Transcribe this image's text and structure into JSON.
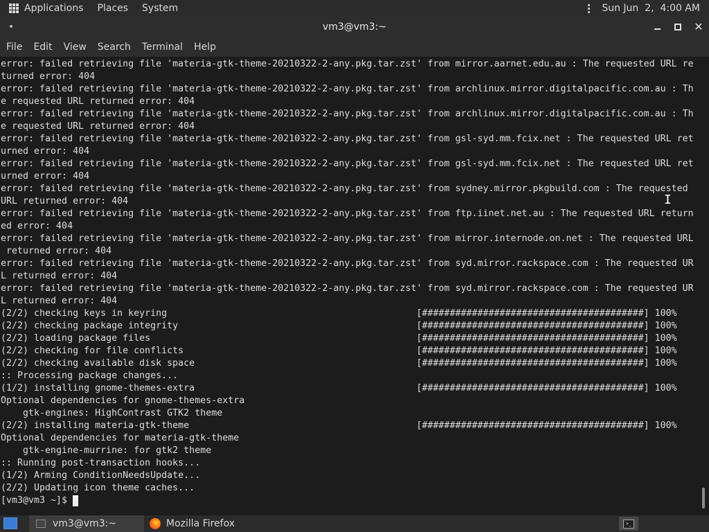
{
  "top_panel": {
    "menus": [
      "Applications",
      "Places",
      "System"
    ],
    "clock": "Sun Jun  2,  4:00 AM"
  },
  "window": {
    "title": "vm3@vm3:~",
    "menu": [
      "File",
      "Edit",
      "View",
      "Search",
      "Terminal",
      "Help"
    ]
  },
  "terminal": {
    "lines": [
      "error: failed retrieving file 'materia-gtk-theme-20210322-2-any.pkg.tar.zst' from mirror.aarnet.edu.au : The requested URL re",
      "turned error: 404",
      "error: failed retrieving file 'materia-gtk-theme-20210322-2-any.pkg.tar.zst' from archlinux.mirror.digitalpacific.com.au : Th",
      "e requested URL returned error: 404",
      "error: failed retrieving file 'materia-gtk-theme-20210322-2-any.pkg.tar.zst' from archlinux.mirror.digitalpacific.com.au : Th",
      "e requested URL returned error: 404",
      "error: failed retrieving file 'materia-gtk-theme-20210322-2-any.pkg.tar.zst' from gsl-syd.mm.fcix.net : The requested URL ret",
      "urned error: 404",
      "error: failed retrieving file 'materia-gtk-theme-20210322-2-any.pkg.tar.zst' from gsl-syd.mm.fcix.net : The requested URL ret",
      "urned error: 404",
      "error: failed retrieving file 'materia-gtk-theme-20210322-2-any.pkg.tar.zst' from sydney.mirror.pkgbuild.com : The requested",
      "URL returned error: 404",
      "error: failed retrieving file 'materia-gtk-theme-20210322-2-any.pkg.tar.zst' from ftp.iinet.net.au : The requested URL return",
      "ed error: 404",
      "error: failed retrieving file 'materia-gtk-theme-20210322-2-any.pkg.tar.zst' from mirror.internode.on.net : The requested URL",
      " returned error: 404",
      "error: failed retrieving file 'materia-gtk-theme-20210322-2-any.pkg.tar.zst' from syd.mirror.rackspace.com : The requested UR",
      "L returned error: 404",
      "error: failed retrieving file 'materia-gtk-theme-20210322-2-any.pkg.tar.zst' from syd.mirror.rackspace.com : The requested UR",
      "L returned error: 404",
      "(2/2) checking keys in keyring                                             [########################################] 100%",
      "(2/2) checking package integrity                                           [########################################] 100%",
      "(2/2) loading package files                                                [########################################] 100%",
      "(2/2) checking for file conflicts                                          [########################################] 100%",
      "(2/2) checking available disk space                                        [########################################] 100%",
      ":: Processing package changes...",
      "(1/2) installing gnome-themes-extra                                        [########################################] 100%",
      "Optional dependencies for gnome-themes-extra",
      "    gtk-engines: HighContrast GTK2 theme",
      "(2/2) installing materia-gtk-theme                                         [########################################] 100%",
      "Optional dependencies for materia-gtk-theme",
      "    gtk-engine-murrine: for gtk2 theme",
      ":: Running post-transaction hooks...",
      "(1/2) Arming ConditionNeedsUpdate...",
      "(2/2) Updating icon theme caches...",
      "[vm3@vm3 ~]$ "
    ]
  },
  "taskbar": {
    "tasks": [
      "vm3@vm3:~",
      "Mozilla Firefox"
    ],
    "terminal_glyph": ">_"
  }
}
